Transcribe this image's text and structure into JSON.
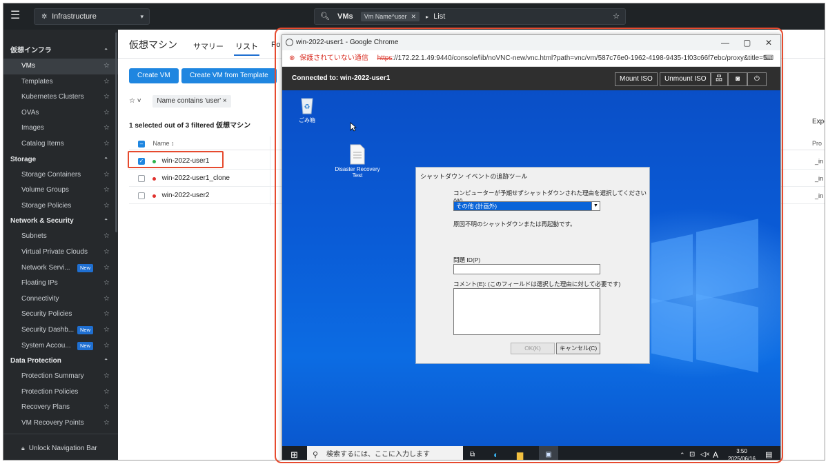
{
  "topbar": {
    "context_label": "Infrastructure",
    "search": {
      "scope": "VMs",
      "chip": "Vm Name^user",
      "view": "List"
    }
  },
  "sidebar": {
    "sections": [
      {
        "title": "仮想インフラ",
        "items": [
          "VMs",
          "Templates",
          "Kubernetes Clusters",
          "OVAs",
          "Images",
          "Catalog Items"
        ]
      },
      {
        "title": "Storage",
        "items": [
          "Storage Containers",
          "Volume Groups",
          "Storage Policies"
        ]
      },
      {
        "title": "Network & Security",
        "items": [
          "Subnets",
          "Virtual Private Clouds",
          "Network Servi...",
          "Floating IPs",
          "Connectivity",
          "Security Policies",
          "Security Dashb...",
          "System Accou..."
        ]
      },
      {
        "title": "Data Protection",
        "items": [
          "Protection Summary",
          "Protection Policies",
          "Recovery Plans",
          "VM Recovery Points"
        ]
      }
    ],
    "new_badge": "New",
    "unlock_label": "Unlock Navigation Bar"
  },
  "main": {
    "title": "仮想マシン",
    "tabs": [
      "サマリー",
      "リスト",
      "Po"
    ],
    "create_vm": "Create VM",
    "create_from_template": "Create VM from Template",
    "filter_chip": "Name contains 'user'",
    "summary": "1 selected out of 3 filtered 仮想マシン",
    "col_name": "Name",
    "rows": [
      "win-2022-user1",
      "win-2022-user1_clone",
      "win-2022-user2"
    ],
    "right_col": [
      "_in",
      "_in",
      "_in"
    ],
    "export_label": "Expo",
    "right_header": "Pro"
  },
  "chrome": {
    "title": "win-2022-user1 - Google Chrome",
    "insecure": "保護されていない通信",
    "url_https": "https",
    "url_rest": "://172.22.1.49:9440/console/lib/noVNC-new/vnc.html?path=vnc/vm/587c76e0-1962-4198-9435-1f03c66f7ebc/proxy&title=5...",
    "connected": "Connected to: win-2022-user1",
    "mount_iso": "Mount ISO",
    "unmount_iso": "Unmount ISO"
  },
  "desktop": {
    "recycle_bin": "ごみ箱",
    "dr_file_line1": "Disaster Recovery",
    "dr_file_line2": "Test"
  },
  "dialog": {
    "title": "シャットダウン イベントの追跡ツール",
    "question": "コンピューターが予期せずシャットダウンされた理由を選択してください(W)",
    "selected_reason": "その他 (計画外)",
    "description": "原因不明のシャットダウンまたは再起動です。",
    "problem_id_label": "問題 ID(P)",
    "comment_label": "コメント(E): (このフィールドは選択した理由に対して必要です)",
    "ok": "OK(K)",
    "cancel": "キャンセル(C)"
  },
  "taskbar": {
    "search_placeholder": "検索するには、ここに入力します",
    "ime": "A",
    "time": "3:50",
    "date": "2025/06/16"
  }
}
